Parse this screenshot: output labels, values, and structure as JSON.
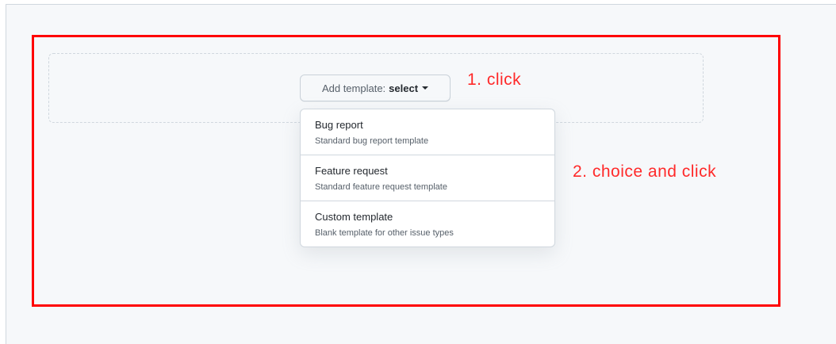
{
  "template_picker": {
    "button_prefix": "Add template:",
    "button_selected": "select",
    "caret_icon": "triangle-down-icon",
    "menu_items": [
      {
        "title": "Bug report",
        "description": "Standard bug report template"
      },
      {
        "title": "Feature request",
        "description": "Standard feature request template"
      },
      {
        "title": "Custom template",
        "description": "Blank template for other issue types"
      }
    ]
  },
  "annotations": {
    "step1": "1. click",
    "step2": "2. choice and click",
    "color": "#ff0000"
  }
}
